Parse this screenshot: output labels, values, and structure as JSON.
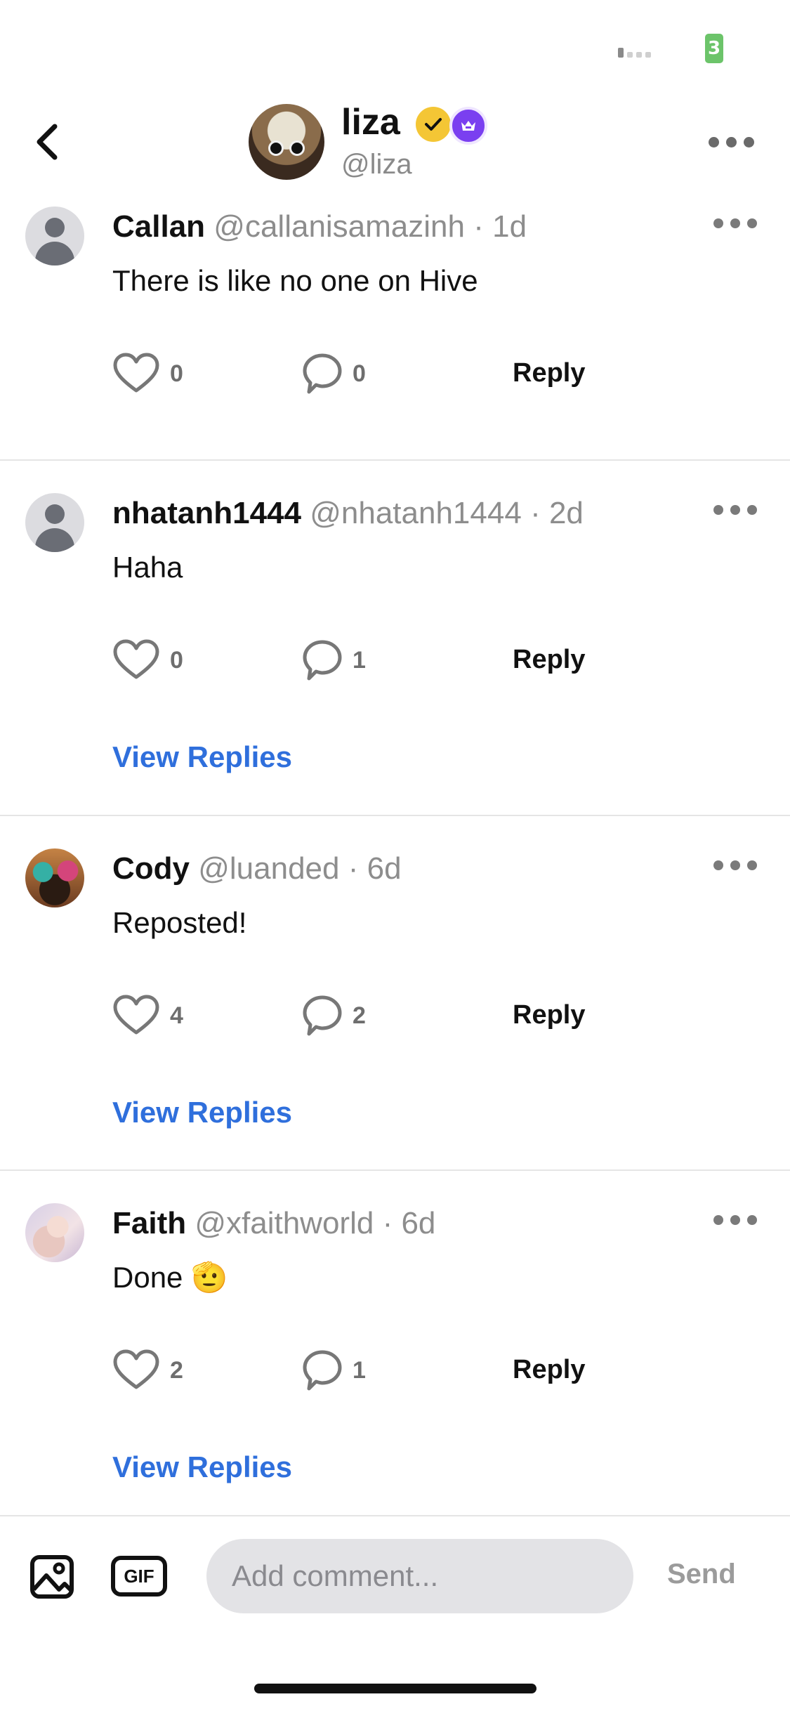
{
  "status_bar": {
    "battery_label": "3",
    "signal_icon": "signal-bars-icon"
  },
  "header": {
    "back_icon": "chevron-left-icon",
    "name": "liza",
    "handle": "@liza",
    "badges": [
      "verified-icon",
      "crown-icon"
    ],
    "accent_color": "#7a3ff0",
    "verified_color": "#f4c635"
  },
  "comments": [
    {
      "name": "Callan",
      "handle": "@callanisamazinh",
      "separator": "·",
      "time": "1d",
      "text": "There is like no one on Hive",
      "likes": "0",
      "replies": "0",
      "reply_label": "Reply"
    },
    {
      "name": "nhatanh1444",
      "handle": "@nhatanh1444",
      "separator": "·",
      "time": "2d",
      "text": "Haha",
      "likes": "0",
      "replies": "1",
      "reply_label": "Reply",
      "view_replies_label": "View Replies"
    },
    {
      "name": "Cody",
      "handle": "@luanded",
      "separator": "·",
      "time": "6d",
      "text": "Reposted!",
      "likes": "4",
      "replies": "2",
      "reply_label": "Reply",
      "view_replies_label": "View Replies"
    },
    {
      "name": "Faith",
      "handle": "@xfaithworld",
      "separator": "·",
      "time": "6d",
      "text": "Done 🫡",
      "likes": "2",
      "replies": "1",
      "reply_label": "Reply",
      "view_replies_label": "View Replies"
    }
  ],
  "composer": {
    "image_icon": "image-icon",
    "gif_label": "GIF",
    "placeholder": "Add comment...",
    "value": "",
    "send_label": "Send"
  },
  "colors": {
    "link": "#2f6fdc",
    "muted": "#8d8d8d",
    "divider": "#e5e5e5"
  }
}
